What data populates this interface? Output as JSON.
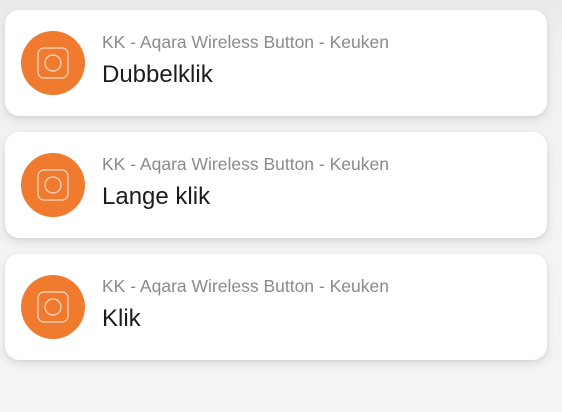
{
  "accent_color": "#f07a2e",
  "notifications": [
    {
      "icon": "button-device-icon",
      "device": "KK - Aqara Wireless Button - Keuken",
      "event": "Dubbelklik"
    },
    {
      "icon": "button-device-icon",
      "device": "KK - Aqara Wireless Button - Keuken",
      "event": "Lange klik"
    },
    {
      "icon": "button-device-icon",
      "device": "KK - Aqara Wireless Button - Keuken",
      "event": "Klik"
    }
  ]
}
